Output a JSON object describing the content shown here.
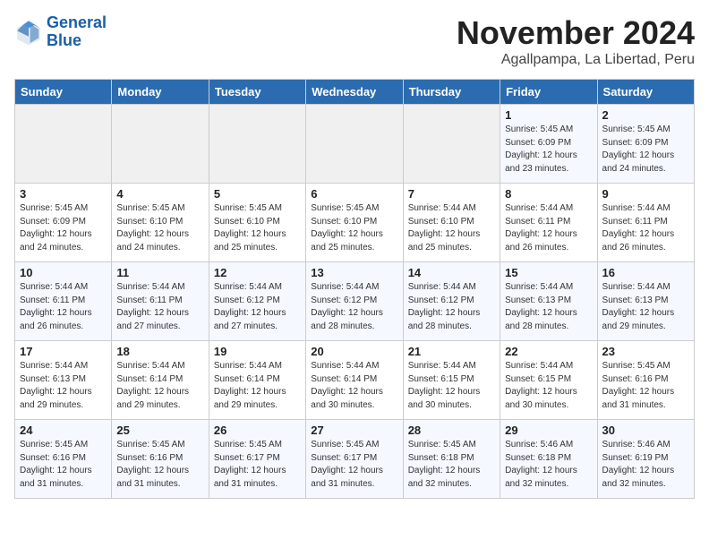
{
  "header": {
    "logo_line1": "General",
    "logo_line2": "Blue",
    "month_title": "November 2024",
    "location": "Agallpampa, La Libertad, Peru"
  },
  "weekdays": [
    "Sunday",
    "Monday",
    "Tuesday",
    "Wednesday",
    "Thursday",
    "Friday",
    "Saturday"
  ],
  "weeks": [
    [
      {
        "day": "",
        "info": ""
      },
      {
        "day": "",
        "info": ""
      },
      {
        "day": "",
        "info": ""
      },
      {
        "day": "",
        "info": ""
      },
      {
        "day": "",
        "info": ""
      },
      {
        "day": "1",
        "info": "Sunrise: 5:45 AM\nSunset: 6:09 PM\nDaylight: 12 hours and 23 minutes."
      },
      {
        "day": "2",
        "info": "Sunrise: 5:45 AM\nSunset: 6:09 PM\nDaylight: 12 hours and 24 minutes."
      }
    ],
    [
      {
        "day": "3",
        "info": "Sunrise: 5:45 AM\nSunset: 6:09 PM\nDaylight: 12 hours and 24 minutes."
      },
      {
        "day": "4",
        "info": "Sunrise: 5:45 AM\nSunset: 6:10 PM\nDaylight: 12 hours and 24 minutes."
      },
      {
        "day": "5",
        "info": "Sunrise: 5:45 AM\nSunset: 6:10 PM\nDaylight: 12 hours and 25 minutes."
      },
      {
        "day": "6",
        "info": "Sunrise: 5:45 AM\nSunset: 6:10 PM\nDaylight: 12 hours and 25 minutes."
      },
      {
        "day": "7",
        "info": "Sunrise: 5:44 AM\nSunset: 6:10 PM\nDaylight: 12 hours and 25 minutes."
      },
      {
        "day": "8",
        "info": "Sunrise: 5:44 AM\nSunset: 6:11 PM\nDaylight: 12 hours and 26 minutes."
      },
      {
        "day": "9",
        "info": "Sunrise: 5:44 AM\nSunset: 6:11 PM\nDaylight: 12 hours and 26 minutes."
      }
    ],
    [
      {
        "day": "10",
        "info": "Sunrise: 5:44 AM\nSunset: 6:11 PM\nDaylight: 12 hours and 26 minutes."
      },
      {
        "day": "11",
        "info": "Sunrise: 5:44 AM\nSunset: 6:11 PM\nDaylight: 12 hours and 27 minutes."
      },
      {
        "day": "12",
        "info": "Sunrise: 5:44 AM\nSunset: 6:12 PM\nDaylight: 12 hours and 27 minutes."
      },
      {
        "day": "13",
        "info": "Sunrise: 5:44 AM\nSunset: 6:12 PM\nDaylight: 12 hours and 28 minutes."
      },
      {
        "day": "14",
        "info": "Sunrise: 5:44 AM\nSunset: 6:12 PM\nDaylight: 12 hours and 28 minutes."
      },
      {
        "day": "15",
        "info": "Sunrise: 5:44 AM\nSunset: 6:13 PM\nDaylight: 12 hours and 28 minutes."
      },
      {
        "day": "16",
        "info": "Sunrise: 5:44 AM\nSunset: 6:13 PM\nDaylight: 12 hours and 29 minutes."
      }
    ],
    [
      {
        "day": "17",
        "info": "Sunrise: 5:44 AM\nSunset: 6:13 PM\nDaylight: 12 hours and 29 minutes."
      },
      {
        "day": "18",
        "info": "Sunrise: 5:44 AM\nSunset: 6:14 PM\nDaylight: 12 hours and 29 minutes."
      },
      {
        "day": "19",
        "info": "Sunrise: 5:44 AM\nSunset: 6:14 PM\nDaylight: 12 hours and 29 minutes."
      },
      {
        "day": "20",
        "info": "Sunrise: 5:44 AM\nSunset: 6:14 PM\nDaylight: 12 hours and 30 minutes."
      },
      {
        "day": "21",
        "info": "Sunrise: 5:44 AM\nSunset: 6:15 PM\nDaylight: 12 hours and 30 minutes."
      },
      {
        "day": "22",
        "info": "Sunrise: 5:44 AM\nSunset: 6:15 PM\nDaylight: 12 hours and 30 minutes."
      },
      {
        "day": "23",
        "info": "Sunrise: 5:45 AM\nSunset: 6:16 PM\nDaylight: 12 hours and 31 minutes."
      }
    ],
    [
      {
        "day": "24",
        "info": "Sunrise: 5:45 AM\nSunset: 6:16 PM\nDaylight: 12 hours and 31 minutes."
      },
      {
        "day": "25",
        "info": "Sunrise: 5:45 AM\nSunset: 6:16 PM\nDaylight: 12 hours and 31 minutes."
      },
      {
        "day": "26",
        "info": "Sunrise: 5:45 AM\nSunset: 6:17 PM\nDaylight: 12 hours and 31 minutes."
      },
      {
        "day": "27",
        "info": "Sunrise: 5:45 AM\nSunset: 6:17 PM\nDaylight: 12 hours and 31 minutes."
      },
      {
        "day": "28",
        "info": "Sunrise: 5:45 AM\nSunset: 6:18 PM\nDaylight: 12 hours and 32 minutes."
      },
      {
        "day": "29",
        "info": "Sunrise: 5:46 AM\nSunset: 6:18 PM\nDaylight: 12 hours and 32 minutes."
      },
      {
        "day": "30",
        "info": "Sunrise: 5:46 AM\nSunset: 6:19 PM\nDaylight: 12 hours and 32 minutes."
      }
    ]
  ]
}
